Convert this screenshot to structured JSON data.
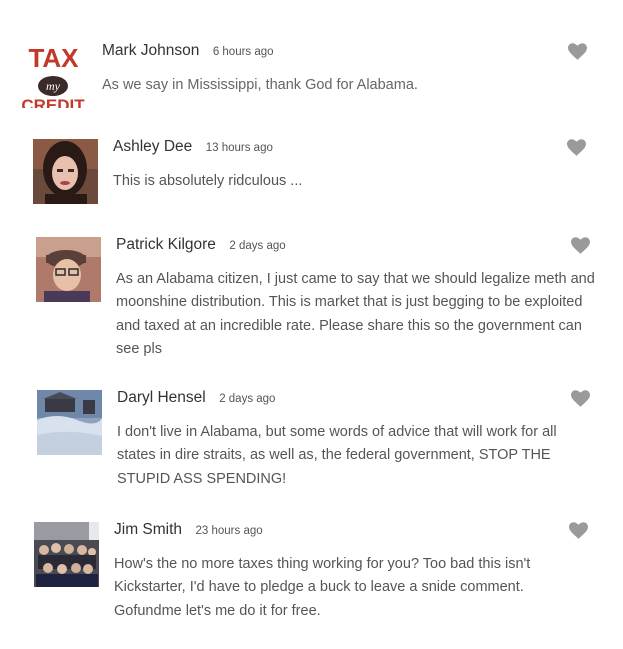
{
  "comments": [
    {
      "author": "Mark Johnson",
      "time": "6 hours ago",
      "text": "As we say in Mississippi, thank God for Alabama.",
      "avatar": {
        "kind": "logo",
        "logo_text": [
          "TAX",
          "my",
          "CREDIT"
        ]
      },
      "like_icon": "heart-icon"
    },
    {
      "author": "Ashley Dee",
      "time": "13 hours ago",
      "text": "This is absolutely ridculous ...",
      "avatar": {
        "kind": "photo"
      },
      "like_icon": "heart-icon"
    },
    {
      "author": "Patrick Kilgore",
      "time": "2 days ago",
      "text": "As an Alabama citizen, I just came to say that we should legalize meth and moonshine distribution. This is market that is just begging to be exploited and taxed at an incredible rate. Please share this so the government can see pls",
      "avatar": {
        "kind": "photo"
      },
      "like_icon": "heart-icon"
    },
    {
      "author": "Daryl Hensel",
      "time": "2 days ago",
      "text": "I don't live in Alabama, but some words of advice that will work for all states in dire straits, as well as, the federal government, STOP THE STUPID ASS SPENDING!",
      "avatar": {
        "kind": "photo"
      },
      "like_icon": "heart-icon"
    },
    {
      "author": "Jim Smith",
      "time": "23 hours ago",
      "text": "How's the no more taxes thing working for you? Too bad this isn't Kickstarter, I'd have to pledge a buck to leave a snide comment. Gofundme let's me do it for free.",
      "avatar": {
        "kind": "photo"
      },
      "like_icon": "heart-icon"
    }
  ],
  "colors": {
    "author": "#333333",
    "text": "#555555",
    "heart": "#9a9a9a"
  }
}
